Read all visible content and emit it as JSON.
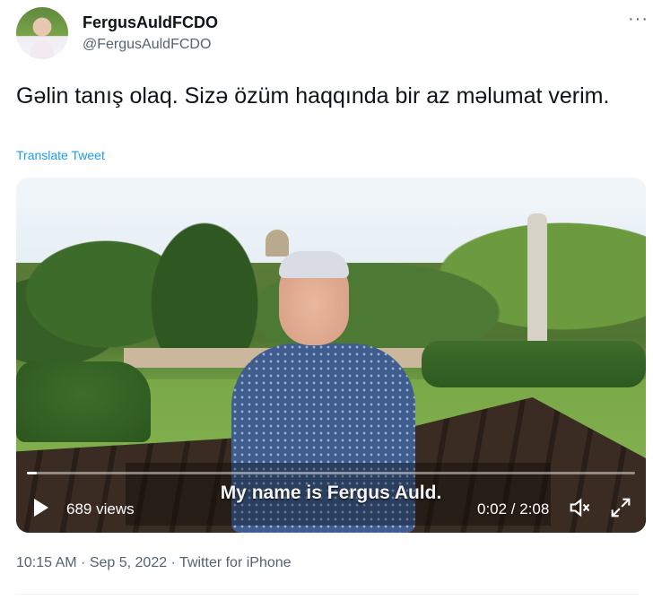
{
  "author": {
    "display_name": "FergusAuldFCDO",
    "handle": "@FergusAuldFCDO",
    "avatar_icon": "avatar-photo"
  },
  "more_label": "···",
  "tweet": {
    "text": "Gəlin tanış olaq. Sizə özüm haqqında bir az məlumat verim.",
    "translate_label": "Translate Tweet"
  },
  "video": {
    "caption": "My name is Fergus Auld.",
    "views": "689 views",
    "time": "0:02 / 2:08",
    "progress_fraction": 0.016,
    "play_icon": "play-icon",
    "volume_icon": "volume-icon",
    "fullscreen_icon": "fullscreen-icon"
  },
  "meta": {
    "timestamp": "10:15 AM · Sep 5, 2022 · Twitter for iPhone"
  },
  "colors": {
    "link": "#1d9bf0",
    "secondary_text": "#536471",
    "primary_text": "#0f1419"
  }
}
